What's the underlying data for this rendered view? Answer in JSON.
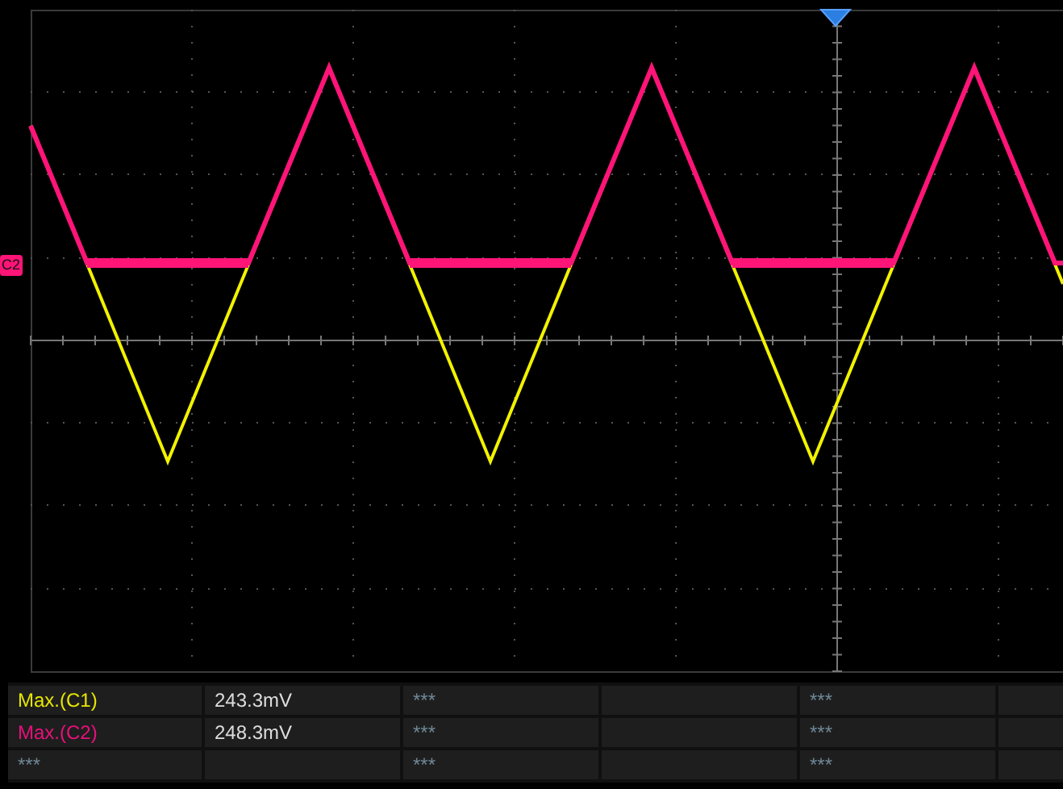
{
  "scope": {
    "channel_marker": {
      "label": "C2"
    }
  },
  "measurements": {
    "rows": [
      {
        "label": "Max.(C1)",
        "color": "#e6e600",
        "value": "243.3mV",
        "column_3": "***",
        "column_5": "***"
      },
      {
        "label": "Max.(C2)",
        "color": "#e8107a",
        "value": "248.3mV",
        "column_3": "***",
        "column_5": "***"
      },
      {
        "label": "***",
        "color": "#6f8896",
        "column_3": "***",
        "column_5": "***"
      }
    ]
  }
}
